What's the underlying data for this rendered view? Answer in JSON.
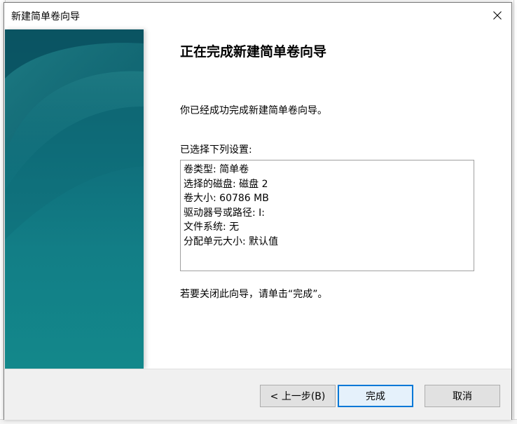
{
  "window": {
    "title": "新建简单卷向导"
  },
  "content": {
    "heading": "正在完成新建简单卷向导",
    "description": "你已经成功完成新建简单卷向导。",
    "settings_label": "已选择下列设置:",
    "settings": [
      "卷类型: 简单卷",
      "选择的磁盘: 磁盘 2",
      "卷大小: 60786 MB",
      "驱动器号或路径: I:",
      "文件系统: 无",
      "分配单元大小: 默认值"
    ],
    "close_hint": "若要关闭此向导，请单击“完成”。"
  },
  "buttons": {
    "back": "< 上一步(B)",
    "finish": "完成",
    "cancel": "取消"
  },
  "colors": {
    "accent": "#0078d7",
    "panel_top": "#0b5a69",
    "panel_bottom": "#13888b"
  },
  "icons": {
    "close": "close-icon"
  }
}
